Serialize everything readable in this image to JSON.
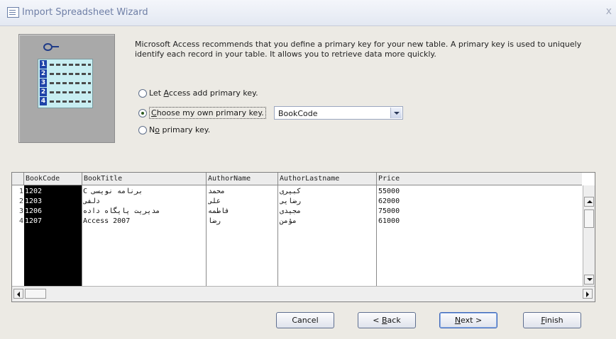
{
  "window": {
    "title": "Import Spreadsheet Wizard",
    "close_glyph": "x"
  },
  "description": "Microsoft Access recommends that you define a primary key for your new table. A primary key is used to uniquely identify each record in your table. It allows you to retrieve data more quickly.",
  "graphic": {
    "rows": [
      "1",
      "2",
      "3",
      "2",
      "4"
    ]
  },
  "options": {
    "let_access": {
      "pre": "Let ",
      "key": "A",
      "post": "ccess add primary key."
    },
    "choose_own": {
      "pre": "",
      "key": "C",
      "post": "hoose my own primary key."
    },
    "no_key": {
      "pre": "N",
      "key": "o",
      "post": " primary key."
    },
    "selected": "choose_own"
  },
  "key_combo": {
    "value": "BookCode"
  },
  "grid": {
    "headers": [
      "BookCode",
      "BookTitle",
      "AuthorName",
      "AuthorLastname",
      "Price"
    ],
    "rows": [
      {
        "num": "1",
        "cells": [
          "1202",
          "C برنامه نویسی",
          "محمد",
          "کبیری",
          "55000"
        ]
      },
      {
        "num": "2",
        "cells": [
          "1203",
          "دلفی",
          "علی",
          "رضایی",
          "62000"
        ]
      },
      {
        "num": "3",
        "cells": [
          "1206",
          "مدیریت پایگاه داده",
          "فاطمه",
          "مجیدی",
          "75000"
        ]
      },
      {
        "num": "4",
        "cells": [
          "1207",
          "Access 2007",
          "رضا",
          "مؤمن",
          "61000"
        ]
      }
    ]
  },
  "buttons": {
    "cancel": {
      "pre": "Cancel",
      "key": "",
      "post": ""
    },
    "back": {
      "pre": "< ",
      "key": "B",
      "post": "ack"
    },
    "next": {
      "pre": "",
      "key": "N",
      "post": "ext >"
    },
    "finish": {
      "pre": "",
      "key": "F",
      "post": "inish"
    }
  },
  "colors": {
    "accent": "#3d66b8",
    "selected_column_bg": "#000000",
    "graphic_bg": "#a9a9a9"
  },
  "icons": [
    "table-key-icon",
    "close-icon",
    "dropdown-arrow-icon",
    "scroll-up-icon",
    "scroll-down-icon",
    "scroll-left-icon",
    "scroll-right-icon"
  ]
}
